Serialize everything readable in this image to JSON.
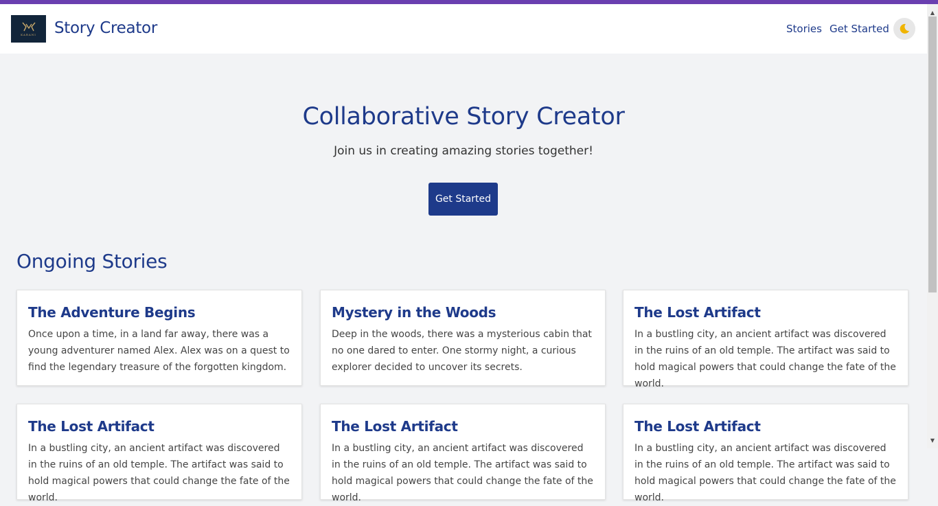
{
  "colors": {
    "accent": "#1e3a8a",
    "top_bar": "#6a3fb0",
    "background": "#f2f3f5",
    "moon": "#f0b400"
  },
  "header": {
    "logo_text": "KARANI",
    "brand": "Story Creator",
    "nav": [
      "Stories",
      "Get Started"
    ],
    "theme_icon": "moon-icon"
  },
  "hero": {
    "title": "Collaborative Story Creator",
    "subtitle": "Join us in creating amazing stories together!",
    "button": "Get Started"
  },
  "stories": {
    "heading": "Ongoing Stories",
    "cards": [
      {
        "title": "The Adventure Begins",
        "text": "Once upon a time, in a land far away, there was a young adventurer named Alex. Alex was on a quest to find the legendary treasure of the forgotten kingdom."
      },
      {
        "title": "Mystery in the Woods",
        "text": "Deep in the woods, there was a mysterious cabin that no one dared to enter. One stormy night, a curious explorer decided to uncover its secrets."
      },
      {
        "title": "The Lost Artifact",
        "text": "In a bustling city, an ancient artifact was discovered in the ruins of an old temple. The artifact was said to hold magical powers that could change the fate of the world."
      },
      {
        "title": "The Lost Artifact",
        "text": "In a bustling city, an ancient artifact was discovered in the ruins of an old temple. The artifact was said to hold magical powers that could change the fate of the world."
      },
      {
        "title": "The Lost Artifact",
        "text": "In a bustling city, an ancient artifact was discovered in the ruins of an old temple. The artifact was said to hold magical powers that could change the fate of the world."
      },
      {
        "title": "The Lost Artifact",
        "text": "In a bustling city, an ancient artifact was discovered in the ruins of an old temple. The artifact was said to hold magical powers that could change the fate of the world."
      }
    ]
  }
}
